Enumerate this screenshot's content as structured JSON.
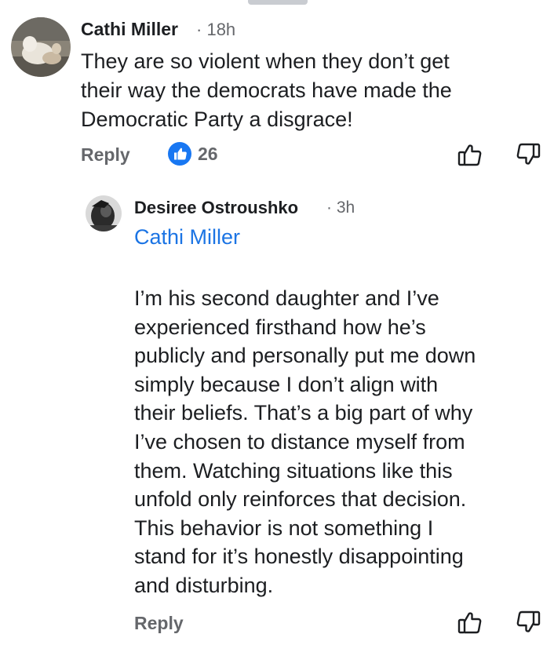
{
  "comment": {
    "author": "Cathi Miller",
    "separator": "·",
    "time": "18h",
    "lines": [
      "They are so violent when they don’t get",
      "their way the democrats have made the",
      "Democratic Party a disgrace!"
    ],
    "reply_label": "Reply",
    "reaction_count": "26"
  },
  "reply": {
    "author": "Desiree Ostroushko",
    "separator": "·",
    "time": "3h",
    "mention": "Cathi Miller",
    "lines": [
      "I’m his second daughter and I’ve",
      "experienced firsthand how he’s",
      "publicly and personally put me down",
      "simply because I don’t align with",
      "their beliefs. That’s a big part of why",
      "I’ve chosen to distance myself from",
      "them. Watching situations like this",
      "unfold only reinforces that decision.",
      "This behavior is not something I",
      "stand for it’s honestly disappointing",
      "and disturbing."
    ],
    "reply_label": "Reply"
  },
  "colors": {
    "link": "#1b74e4",
    "muted": "#65676b",
    "text": "#1c1e21",
    "like_badge": "#1877f2"
  },
  "icons": [
    "thumbs-up-icon",
    "thumbs-down-icon",
    "like-reaction-icon"
  ]
}
